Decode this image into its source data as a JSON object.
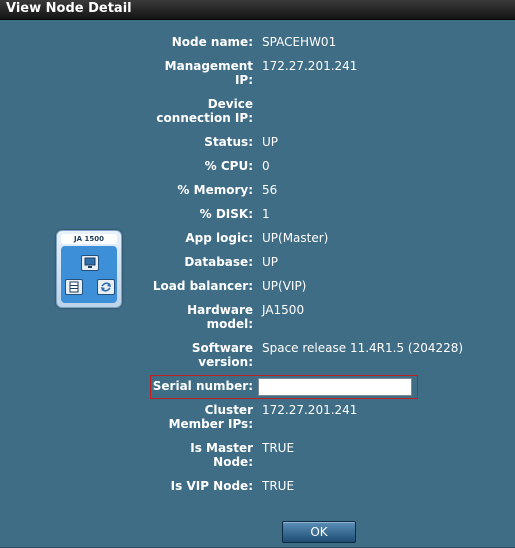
{
  "window": {
    "title": "View Node Detail"
  },
  "device": {
    "model_label": "JA 1500"
  },
  "fields": [
    {
      "label": "Node name:",
      "value": "SPACEHW01"
    },
    {
      "label": "Management IP:",
      "value": "172.27.201.241"
    },
    {
      "label": "Device connection IP:",
      "value": ""
    },
    {
      "label": "Status:",
      "value": "UP"
    },
    {
      "label": "% CPU:",
      "value": "0"
    },
    {
      "label": "% Memory:",
      "value": "56"
    },
    {
      "label": "% DISK:",
      "value": "1"
    },
    {
      "label": "App logic:",
      "value": "UP(Master)"
    },
    {
      "label": "Database:",
      "value": "UP"
    },
    {
      "label": "Load balancer:",
      "value": "UP(VIP)"
    },
    {
      "label": "Hardware model:",
      "value": "JA1500"
    },
    {
      "label": "Software version:",
      "value": "Space release 11.4R1.5 (204228)"
    },
    {
      "label": "Serial number:",
      "value": ""
    },
    {
      "label": "Cluster Member IPs:",
      "value": "172.27.201.241"
    },
    {
      "label": "Is Master Node:",
      "value": "TRUE"
    },
    {
      "label": "Is VIP Node:",
      "value": "TRUE"
    }
  ],
  "label_lines": {
    "management_ip": [
      "Management",
      "IP:"
    ],
    "device_connection_ip": [
      "Device",
      "connection IP:"
    ],
    "hardware_model": [
      "Hardware",
      "model:"
    ],
    "software_version": [
      "Software",
      "version:"
    ],
    "cluster_member_ips": [
      "Cluster",
      "Member IPs:"
    ],
    "is_master_node": [
      "Is Master",
      "Node:"
    ]
  },
  "buttons": {
    "ok_label": "OK"
  },
  "colors": {
    "background": "#3f6d86",
    "titlebar": "#1a1a1a",
    "highlight_border": "#c02020"
  }
}
